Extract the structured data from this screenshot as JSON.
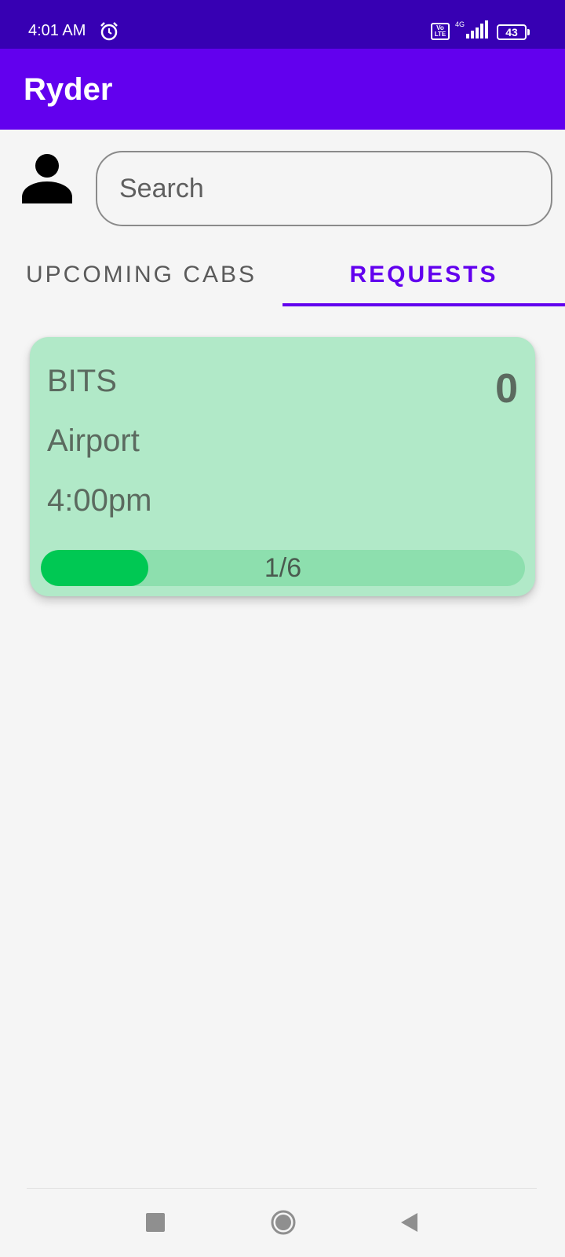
{
  "status_bar": {
    "time": "4:01 AM",
    "network": "4G",
    "volte_line1": "Vo",
    "volte_line2": "LTE",
    "battery": "43"
  },
  "app_bar": {
    "title": "Ryder"
  },
  "search": {
    "placeholder": "Search"
  },
  "tabs": [
    {
      "label": "UPCOMING CABS",
      "selected": false
    },
    {
      "label": "REQUESTS",
      "selected": true
    }
  ],
  "cards": [
    {
      "from": "BITS",
      "to": "Airport",
      "time": "4:00pm",
      "count": "0",
      "progress_label": "1/6",
      "progress_fraction": 0.2222
    }
  ],
  "colors": {
    "status_bar": "#3700b3",
    "app_bar": "#6200ee",
    "accent": "#6200ee",
    "card_background": "#b1e9c8",
    "progress_track": "#8ddfae",
    "progress_fill": "#00c853"
  },
  "nav_bar": {
    "icons": [
      "recent-apps-icon",
      "home-icon",
      "back-icon"
    ]
  }
}
